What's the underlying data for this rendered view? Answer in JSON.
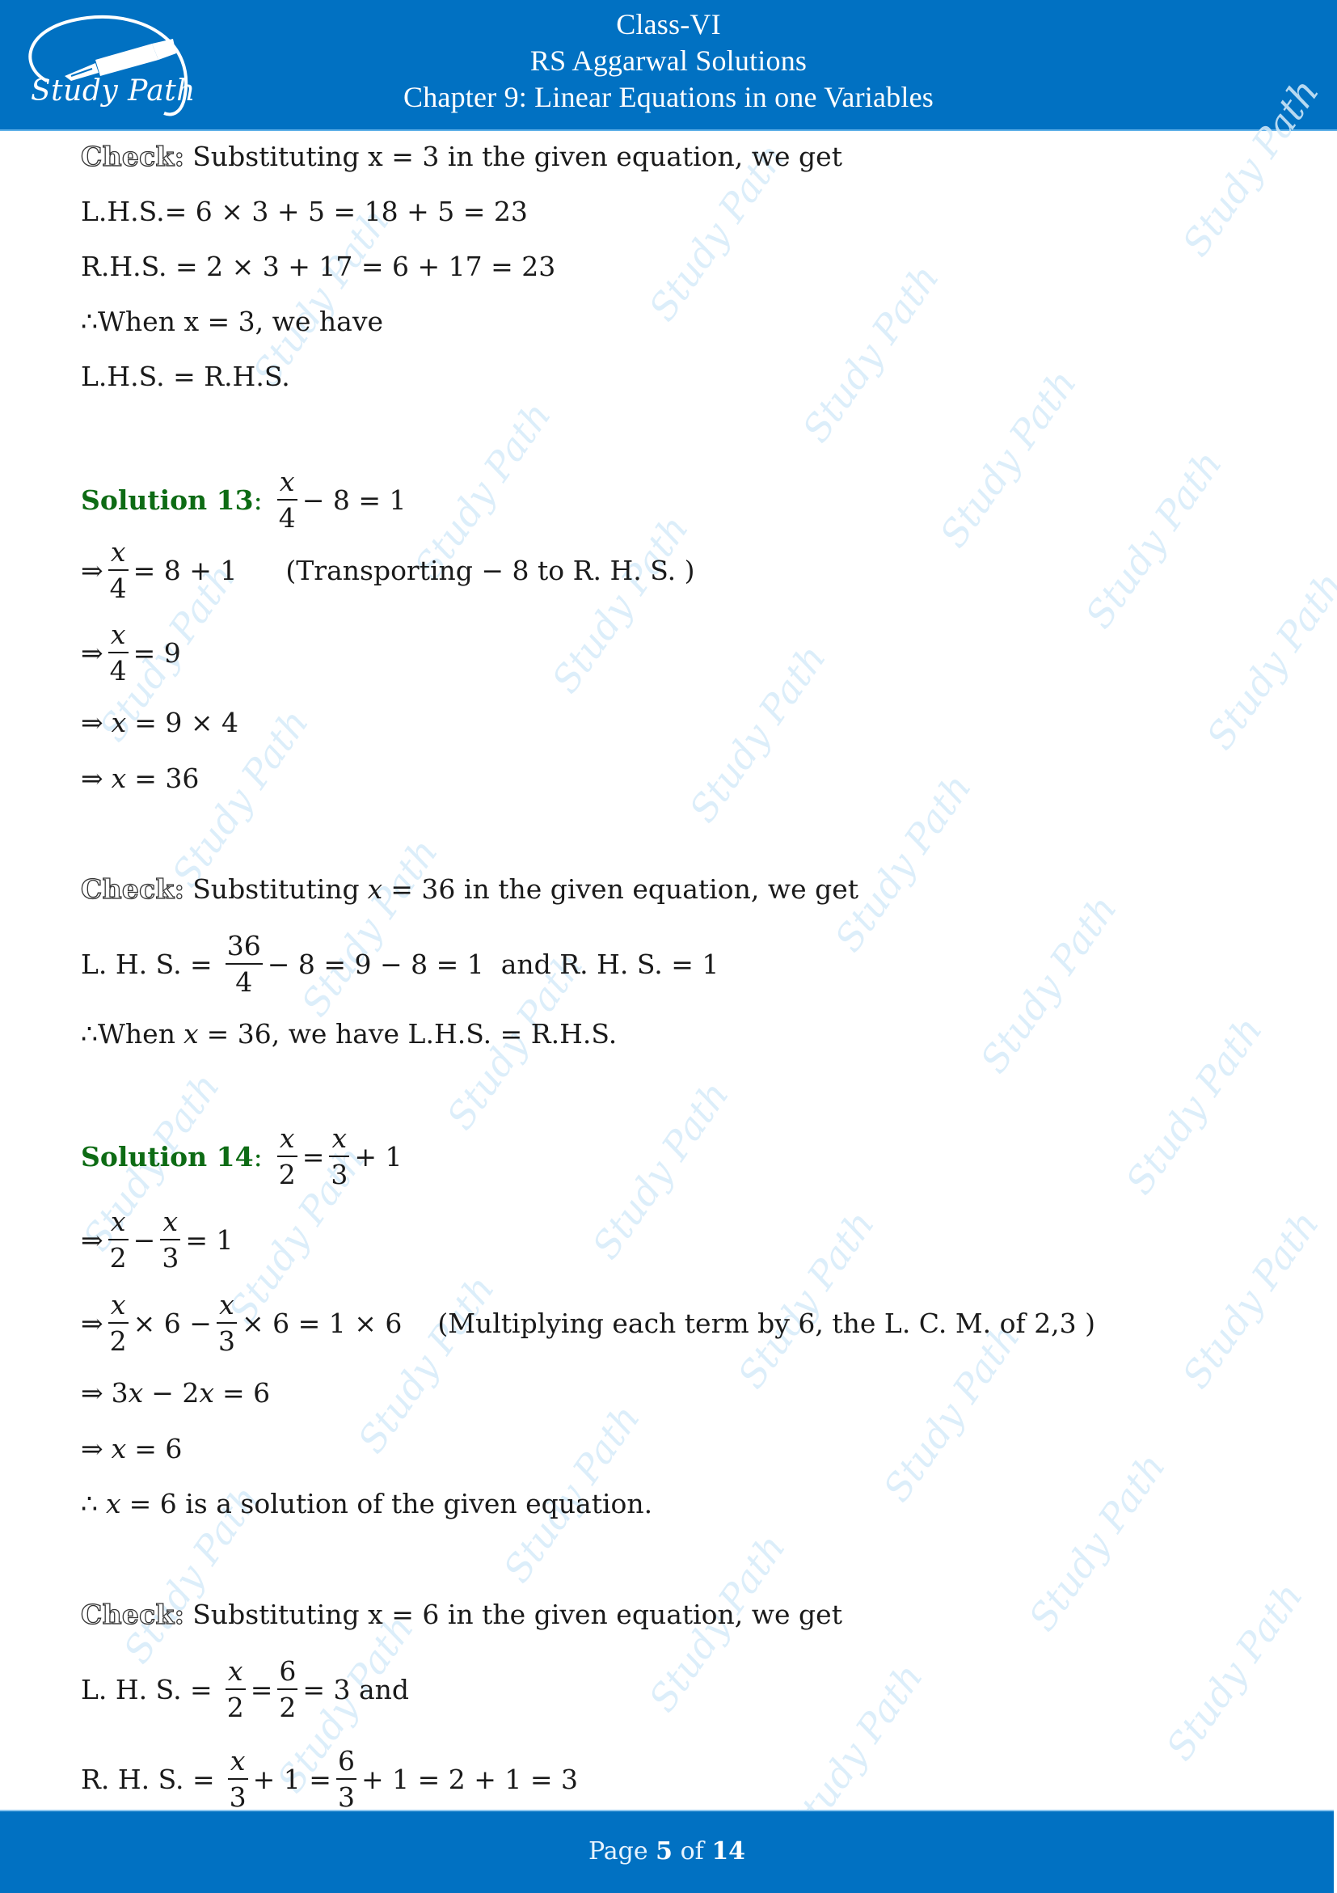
{
  "header": {
    "logo_text": "Study Path",
    "class": "Class-VI",
    "book": "RS Aggarwal Solutions",
    "chapter": "Chapter 9: Linear Equations in one Variables"
  },
  "footer": {
    "prefix": "Page",
    "current": "5",
    "middle": "of",
    "total": "14"
  },
  "watermark": "Study Path",
  "colors": {
    "header_bg": "#0171c2",
    "solution_heading": "#0d6b14",
    "watermark": "#d7ecfa"
  },
  "check12": {
    "label": "Check:",
    "text": "Substituting x = 3 in the given equation, we get",
    "lhs": "L.H.S.= 6 × 3 + 5 = 18 + 5 = 23",
    "rhs": "R.H.S. = 2 × 3 + 17 = 6 + 17 = 23",
    "when": "∴When x = 3, we have",
    "conclusion": "L.H.S. = R.H.S."
  },
  "solution13": {
    "label": "Solution 13",
    "colon": ":",
    "equation": {
      "num": "x",
      "den": "4",
      "rest": "− 8 = 1"
    },
    "steps": [
      {
        "prefix": "⇒",
        "num": "x",
        "den": "4",
        "rest": "= 8 + 1",
        "note": "(Transporting − 8 to R. H. S. )"
      },
      {
        "prefix": "⇒",
        "num": "x",
        "den": "4",
        "rest": "= 9"
      },
      {
        "prefix": "⇒",
        "var": "x",
        "rest": "= 9 × 4"
      },
      {
        "prefix": "⇒",
        "var": "x",
        "rest": "= 36"
      }
    ],
    "check": {
      "label": "Check:",
      "text_before": "Substituting",
      "var": "x",
      "text_after": "= 36 in the given equation, we get",
      "lhs_label": "L. H. S. =",
      "lhs_num": "36",
      "lhs_den": "4",
      "lhs_rest": "− 8 = 9 − 8 = 1  and R. H. S. = 1",
      "when_prefix": "∴When",
      "when_var": "x",
      "when_rest": "= 36, we have L.H.S. = R.H.S."
    }
  },
  "solution14": {
    "label": "Solution 14",
    "colon": ":",
    "equation": {
      "num1": "x",
      "den1": "2",
      "eq": "=",
      "num2": "x",
      "den2": "3",
      "rest": "+ 1"
    },
    "step1": {
      "prefix": "⇒",
      "num1": "x",
      "den1": "2",
      "op": "−",
      "num2": "x",
      "den2": "3",
      "rest": "= 1"
    },
    "step2": {
      "prefix": "⇒",
      "num1": "x",
      "den1": "2",
      "mid": "× 6 −",
      "num2": "x",
      "den2": "3",
      "rest": "× 6 = 1 × 6",
      "note": "(Multiplying each term by 6, the L. C. M. of 2,3 )"
    },
    "step3": {
      "prefix": "⇒",
      "text": "3",
      "var1": "x",
      "mid": "− 2",
      "var2": "x",
      "rest": "= 6"
    },
    "step4": {
      "prefix": "⇒",
      "var": "x",
      "rest": "= 6"
    },
    "conclusion": {
      "prefix": "∴",
      "var": "x",
      "rest": "= 6 is a solution of the given equation."
    },
    "check": {
      "label": "Check:",
      "text": "Substituting x = 6 in the given equation, we get",
      "lhs_label": "L. H. S. =",
      "lhs_num1": "x",
      "lhs_den1": "2",
      "lhs_eq": "=",
      "lhs_num2": "6",
      "lhs_den2": "2",
      "lhs_rest": "= 3 and",
      "rhs_label": "R. H. S. =",
      "rhs_num1": "x",
      "rhs_den1": "3",
      "rhs_mid": "+ 1 =",
      "rhs_num2": "6",
      "rhs_den2": "3",
      "rhs_rest": "+ 1 = 2 + 1 = 3"
    }
  }
}
